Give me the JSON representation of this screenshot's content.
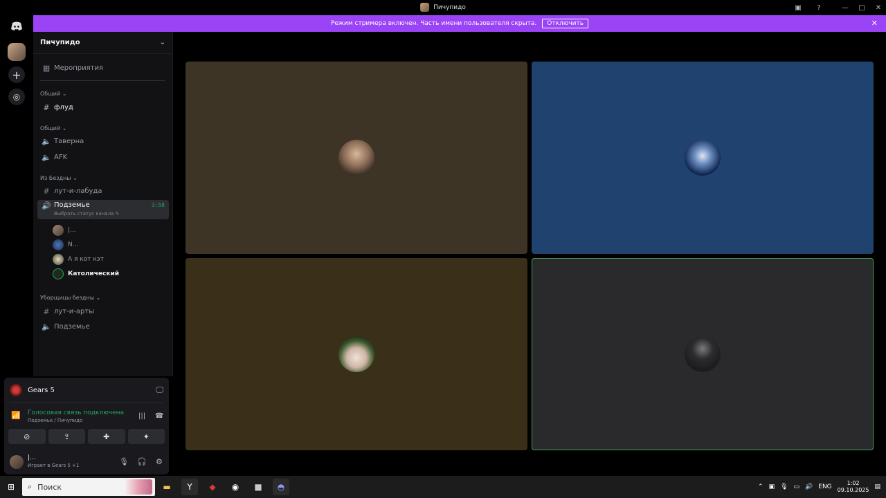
{
  "window": {
    "title": "Пичупидо"
  },
  "banner": {
    "text": "Режим стримера включен. Часть имени пользователя скрыта.",
    "button": "Отключить"
  },
  "guild": {
    "name": "Пичупидо"
  },
  "channels": {
    "events": "Мероприятия",
    "cat1": "Общий",
    "flood": "флуд",
    "cat2": "Общий",
    "taverna": "Таверна",
    "afk": "AFK",
    "cat3": "Из Бездны",
    "loot_labuda": "лут-и-лабуда",
    "podzemie": "Подземье",
    "podzemie_timer": "3:58",
    "podzemie_status": "Выбрать статус канала",
    "members": [
      "|...",
      "N...",
      "А я кот кэт",
      "Католический"
    ],
    "cat4": "Уборщицы бездны",
    "loot_arty": "лут-и-арты",
    "podzemie2": "Подземье"
  },
  "activity": {
    "game": "Gears 5"
  },
  "voice": {
    "status": "Голосовая связь подключена",
    "location": "Подземье / Пичупидо"
  },
  "user": {
    "name": "|...",
    "activity": "Играет в Gears 5 +1"
  },
  "taskbar": {
    "search_placeholder": "Поиск",
    "lang": "ENG",
    "time": "1:02",
    "date": "09.10.2025"
  },
  "colors": {
    "banner": "#9b44f5",
    "connected": "#23a55a",
    "tile1": "#3d3426",
    "tile2": "#1f426e",
    "tile3": "#3a301a",
    "tile4": "#2a2a2c",
    "speaking_border": "#3ba55c"
  }
}
